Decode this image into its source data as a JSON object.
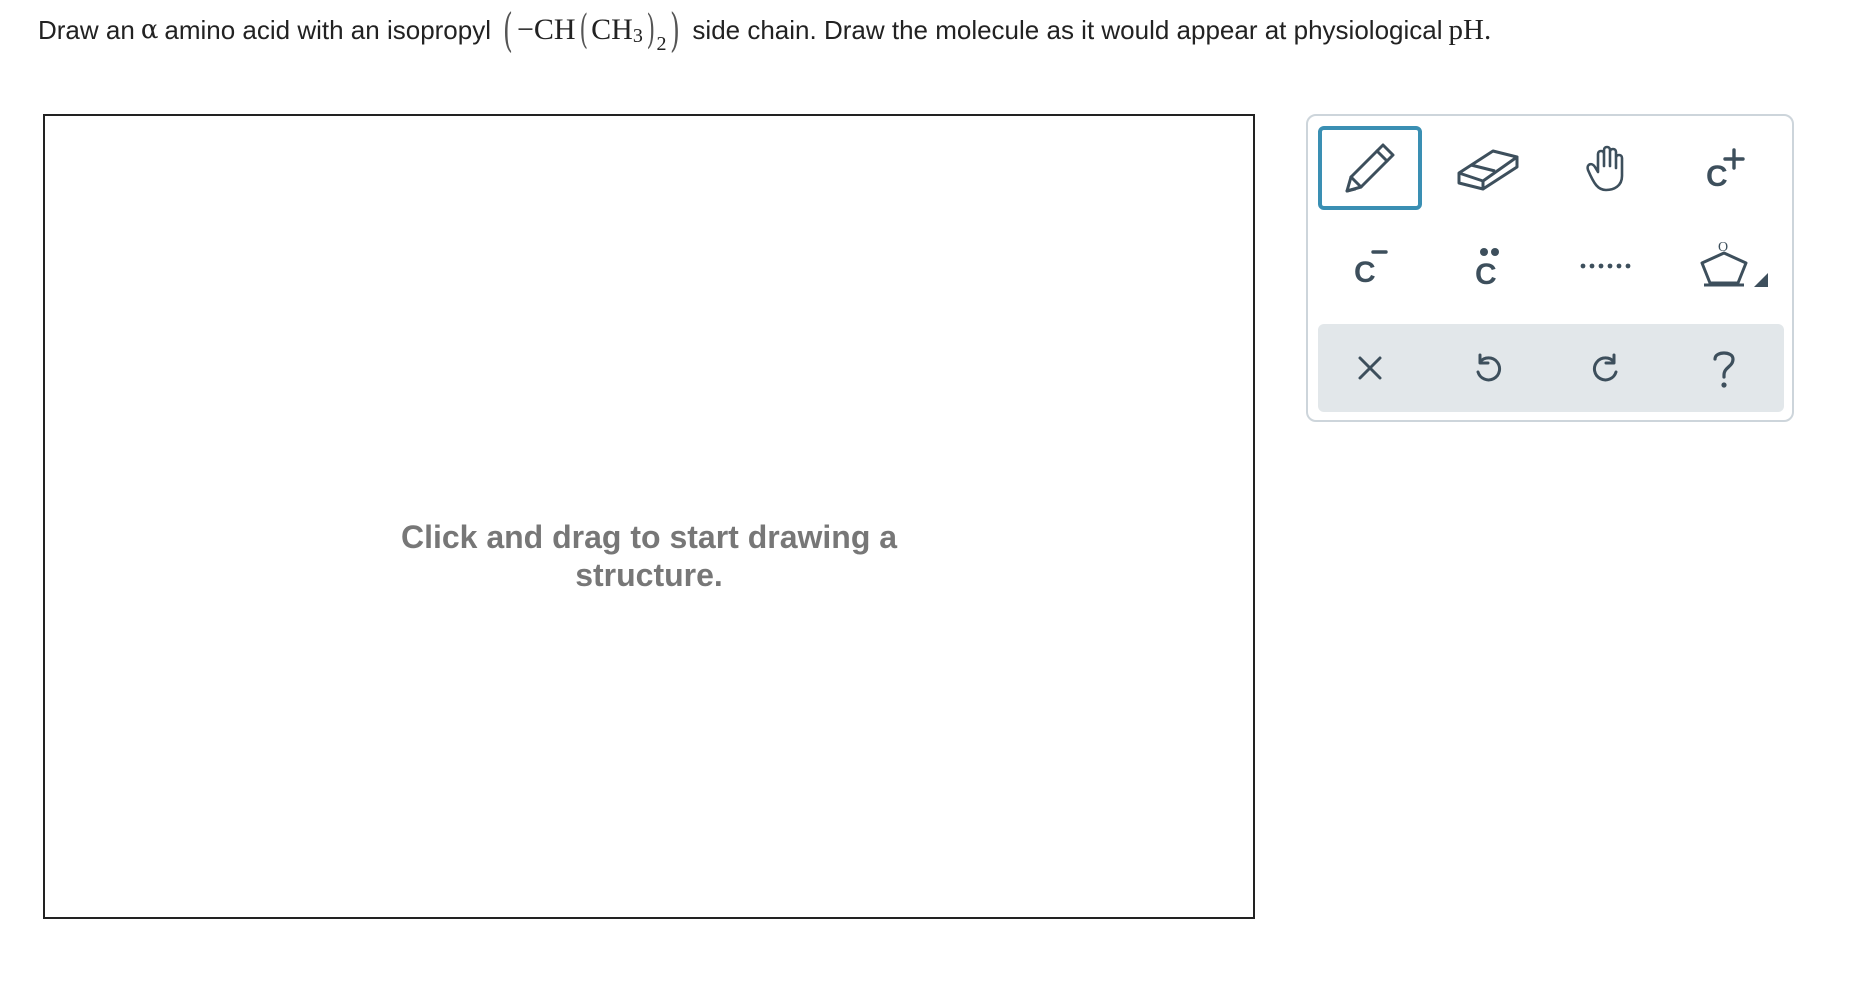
{
  "question": {
    "part1": "Draw an",
    "alpha": "α",
    "part2": "amino acid with an isopropyl",
    "formula_main": "−CH",
    "formula_inner": "CH",
    "formula_sub3": "3",
    "formula_sub2": "2",
    "part3": "side chain. Draw the molecule as it would appear at physiological",
    "pH": "pH."
  },
  "canvas": {
    "hint_line1": "Click and drag to start drawing a",
    "hint_line2": "structure."
  },
  "palette": {
    "accent_color": "#3a8fb3",
    "icon_color": "#3d4f5c",
    "tools": [
      {
        "name": "pencil-icon",
        "selected": true
      },
      {
        "name": "eraser-icon"
      },
      {
        "name": "hand-icon"
      },
      {
        "name": "carbocation-icon",
        "label": "C",
        "sup": "+"
      },
      {
        "name": "carbanion-icon",
        "label": "C",
        "sup": "−"
      },
      {
        "name": "lone-pair-icon",
        "label": "C"
      },
      {
        "name": "dotted-bond-icon"
      },
      {
        "name": "ring-template-icon",
        "label": "O"
      }
    ],
    "actions": [
      {
        "name": "clear-icon",
        "symbol": "×"
      },
      {
        "name": "undo-icon"
      },
      {
        "name": "redo-icon"
      },
      {
        "name": "help-icon",
        "symbol": "?"
      }
    ]
  }
}
